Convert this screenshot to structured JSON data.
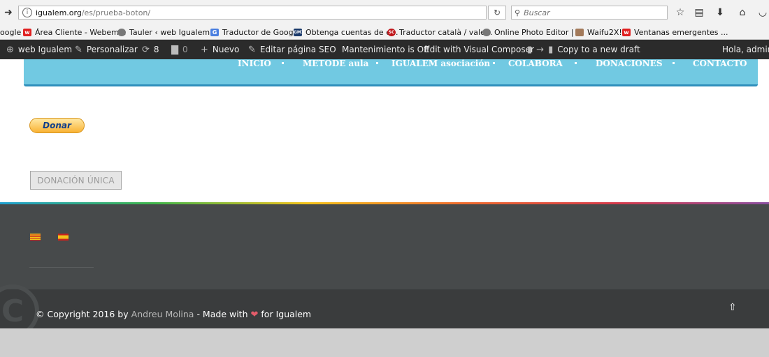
{
  "browser": {
    "url_host": "igualem.org",
    "url_path": "/es/prueba-boton/",
    "search_placeholder": "Buscar"
  },
  "bookmarks": [
    {
      "label": "oogle"
    },
    {
      "label": "Área Cliente - Webem..."
    },
    {
      "label": "Tauler ‹ web Igualem ..."
    },
    {
      "label": "Traductor de Google"
    },
    {
      "label": "Obtenga cuentas de e..."
    },
    {
      "label": "Traductor català / vale..."
    },
    {
      "label": "Online Photo Editor | ..."
    },
    {
      "label": "Waifu2X!"
    },
    {
      "label": "Ventanas emergentes ..."
    }
  ],
  "adminbar": {
    "site": "web Igualem",
    "customize": "Personalizar",
    "updates_count": "8",
    "comments_count": "0",
    "new": "Nuevo",
    "edit_page": "Editar página",
    "seo": "SEO",
    "maintenance": "Mantenimiento is Off",
    "visual_composer": "Edit with Visual Composer",
    "copy_draft": "Copy to a new draft",
    "greeting": "Hola, admin"
  },
  "nav": [
    "INICIO",
    "METODE aula",
    "IGUALEM asociación",
    "COLABORA",
    "DONACIONES",
    "CONTACTO"
  ],
  "main": {
    "donate_label": "Donar",
    "single_donation_label": "DONACIÓN ÚNICA"
  },
  "footer": {
    "copyright_prefix": "© Copyright 2016 by",
    "author": "Andreu Molina",
    "made_with": "- Made with",
    "for_text": "for Igualem"
  },
  "colors": {
    "nav_bg": "#71c9e2",
    "nav_border": "#2f8fbb",
    "footer_dark": "#474a4b",
    "footer_darker": "#3a3c3d",
    "admin_bar": "#2b2b2b",
    "heart": "#e25c6a"
  }
}
